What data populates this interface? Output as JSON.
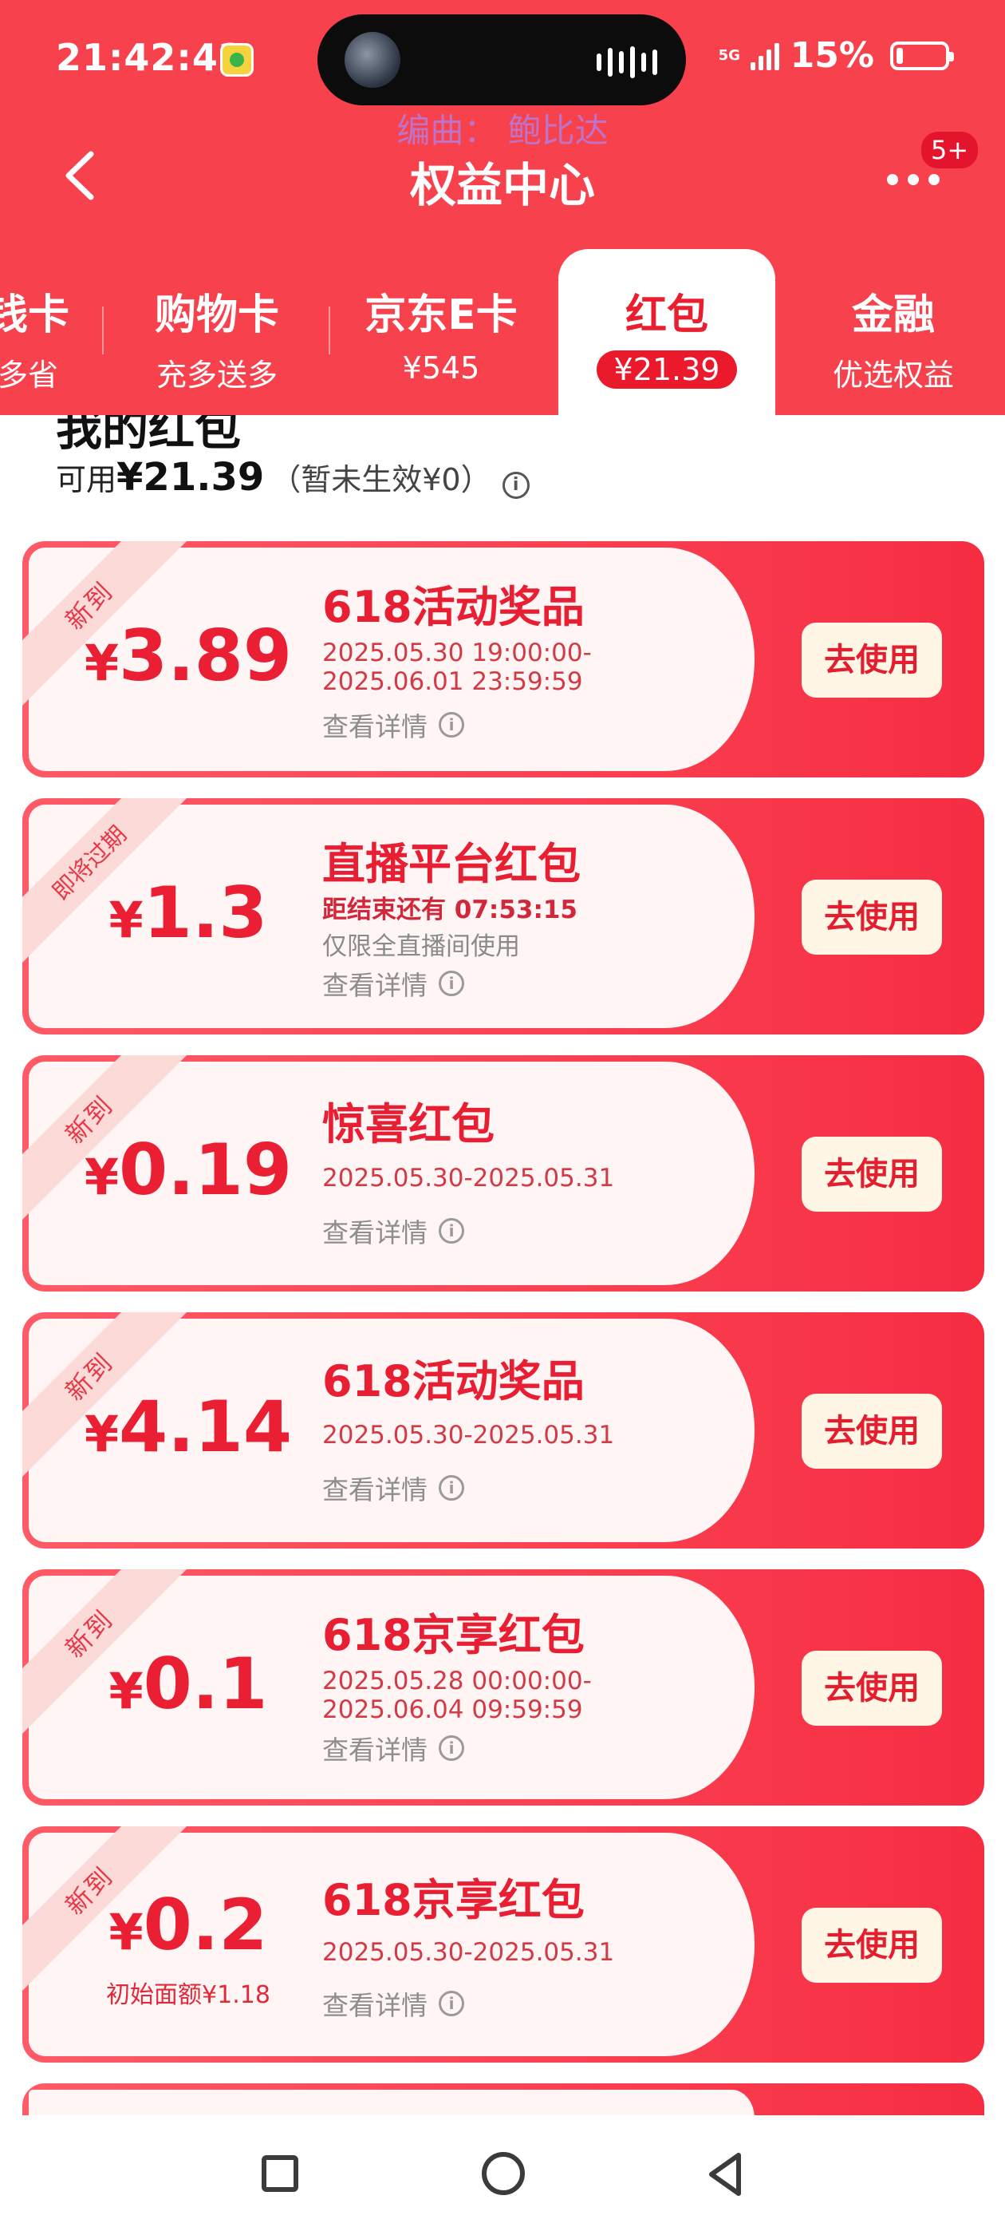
{
  "status_bar": {
    "time": "21:42:42",
    "network": "5G",
    "battery_percent": "15%"
  },
  "watermark": "编曲： 鲍比达",
  "header": {
    "title": "权益中心",
    "more_badge": "5+"
  },
  "tabs": [
    {
      "label": "钱卡",
      "sub": "多省"
    },
    {
      "label": "购物卡",
      "sub": "充多送多"
    },
    {
      "label": "京东E卡",
      "sub": "¥545"
    },
    {
      "label": "红包",
      "sub": "¥21.39",
      "active": true
    },
    {
      "label": "金融",
      "sub": "优选权益"
    }
  ],
  "summary": {
    "section_title": "我的红包",
    "available_label": "可用",
    "available_amount": "¥21.39",
    "pending_text": "（暂未生效¥0）"
  },
  "cards": [
    {
      "tag": "新到",
      "currency": "¥",
      "amount": "3.89",
      "title": "618活动奖品",
      "line1": "2025.05.30 19:00:00-",
      "line2": "2025.06.01 23:59:59",
      "detail": "查看详情",
      "button": "去使用"
    },
    {
      "tag": "即将过期",
      "currency": "¥",
      "amount": "1.3",
      "title": "直播平台红包",
      "line1": "距结束还有 07:53:15",
      "line2": "仅限全直播间使用",
      "detail": "查看详情",
      "button": "去使用"
    },
    {
      "tag": "新到",
      "currency": "¥",
      "amount": "0.19",
      "title": "惊喜红包",
      "line1": "2025.05.30-2025.05.31",
      "detail": "查看详情",
      "button": "去使用"
    },
    {
      "tag": "新到",
      "currency": "¥",
      "amount": "4.14",
      "title": "618活动奖品",
      "line1": "2025.05.30-2025.05.31",
      "detail": "查看详情",
      "button": "去使用"
    },
    {
      "tag": "新到",
      "currency": "¥",
      "amount": "0.1",
      "title": "618京享红包",
      "line1": "2025.05.28 00:00:00-",
      "line2": "2025.06.04 09:59:59",
      "detail": "查看详情",
      "button": "去使用"
    },
    {
      "tag": "新到",
      "currency": "¥",
      "amount": "0.2",
      "amount_sub": "初始面额¥1.18",
      "title": "618京享红包",
      "line1": "2025.05.30-2025.05.31",
      "detail": "查看详情",
      "button": "去使用"
    }
  ],
  "colors": {
    "header_bg": "#f7424e",
    "accent_red": "#ea1f33",
    "card_inner": "#fff5f4",
    "button_bg": "#fff6e6"
  }
}
